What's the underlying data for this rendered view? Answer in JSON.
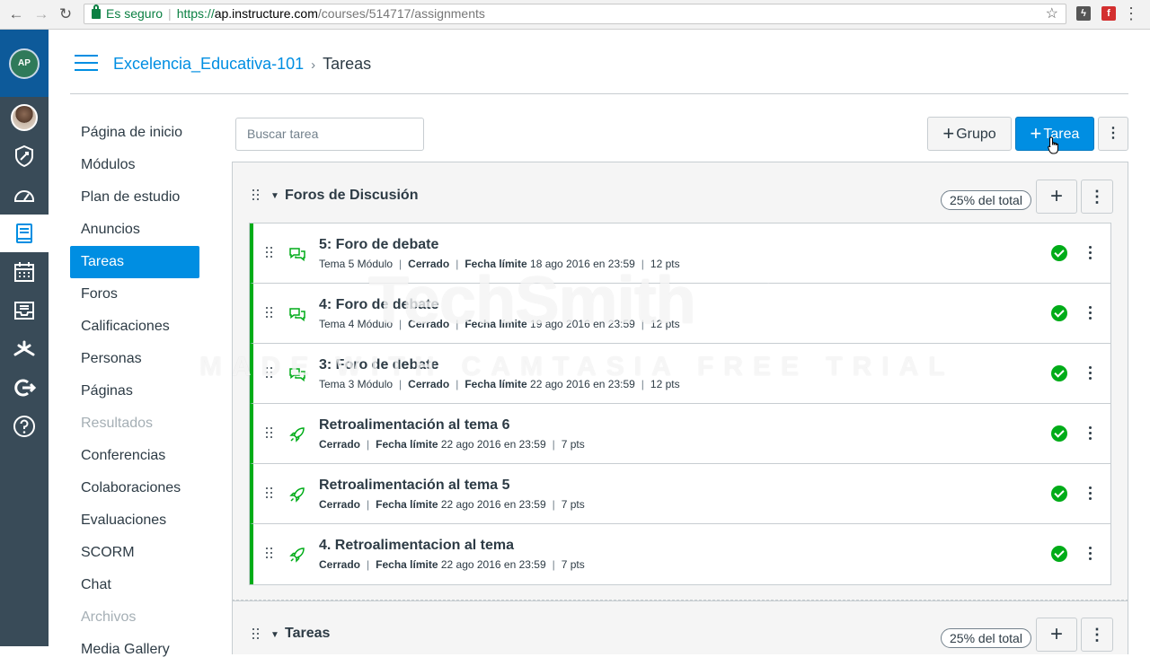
{
  "browser": {
    "secure_label": "Es seguro",
    "url_protocol": "https://",
    "url_host": "ap.instructure.com",
    "url_path": "/courses/514717/assignments"
  },
  "global_nav": {
    "logo_text": "AP",
    "items": [
      "account",
      "admin",
      "dashboard",
      "courses",
      "calendar",
      "inbox",
      "commons",
      "import",
      "help"
    ]
  },
  "breadcrumb": {
    "course": "Excelencia_Educativa-101",
    "separator": "›",
    "current": "Tareas"
  },
  "course_nav": [
    {
      "label": "Página de inicio",
      "state": "normal"
    },
    {
      "label": "Módulos",
      "state": "normal"
    },
    {
      "label": "Plan de estudio",
      "state": "normal"
    },
    {
      "label": "Anuncios",
      "state": "normal"
    },
    {
      "label": "Tareas",
      "state": "active"
    },
    {
      "label": "Foros",
      "state": "normal"
    },
    {
      "label": "Calificaciones",
      "state": "normal"
    },
    {
      "label": "Personas",
      "state": "normal"
    },
    {
      "label": "Páginas",
      "state": "normal"
    },
    {
      "label": "Resultados",
      "state": "disabled"
    },
    {
      "label": "Conferencias",
      "state": "normal"
    },
    {
      "label": "Colaboraciones",
      "state": "normal"
    },
    {
      "label": "Evaluaciones",
      "state": "normal"
    },
    {
      "label": "SCORM",
      "state": "normal"
    },
    {
      "label": "Chat",
      "state": "normal"
    },
    {
      "label": "Archivos",
      "state": "disabled"
    },
    {
      "label": "Media Gallery",
      "state": "normal"
    }
  ],
  "toolbar": {
    "search_placeholder": "Buscar tarea",
    "group_button": "Grupo",
    "task_button": "Tarea"
  },
  "groups": [
    {
      "title": "Foros de Discusión",
      "weight": "25% del total",
      "assignments": [
        {
          "icon": "discussion-icon",
          "title": "5: Foro de debate",
          "module": "Tema 5 Módulo",
          "status": "Cerrado",
          "due_label": "Fecha límite",
          "due": "18 ago 2016 en 23:59",
          "points": "12 pts"
        },
        {
          "icon": "discussion-icon",
          "title": "4: Foro de debate",
          "module": "Tema 4 Módulo",
          "status": "Cerrado",
          "due_label": "Fecha límite",
          "due": "19 ago 2016 en 23:59",
          "points": "12 pts"
        },
        {
          "icon": "discussion-icon",
          "title": "3: Foro de debate",
          "module": "Tema 3 Módulo",
          "status": "Cerrado",
          "due_label": "Fecha límite",
          "due": "22 ago 2016 en 23:59",
          "points": "12 pts"
        },
        {
          "icon": "assignment-icon",
          "title": "Retroalimentación al tema 6",
          "module": "",
          "status": "Cerrado",
          "due_label": "Fecha límite",
          "due": "22 ago 2016 en 23:59",
          "points": "7 pts"
        },
        {
          "icon": "assignment-icon",
          "title": "Retroalimentación al tema 5",
          "module": "",
          "status": "Cerrado",
          "due_label": "Fecha límite",
          "due": "22 ago 2016 en 23:59",
          "points": "7 pts"
        },
        {
          "icon": "assignment-icon",
          "title": "4. Retroalimentacion al tema",
          "module": "",
          "status": "Cerrado",
          "due_label": "Fecha límite",
          "due": "22 ago 2016 en 23:59",
          "points": "7 pts"
        }
      ]
    },
    {
      "title": "Tareas",
      "weight": "25% del total",
      "assignments": []
    }
  ],
  "watermark": {
    "brand": "TechSmith",
    "reg": "®",
    "text": "MADE WITH CAMTASIA FREE TRIAL"
  },
  "colors": {
    "accent": "#008ee2",
    "published": "#00ac18",
    "nav_bg": "#394b58",
    "logo_bg": "#0d5a9a"
  }
}
